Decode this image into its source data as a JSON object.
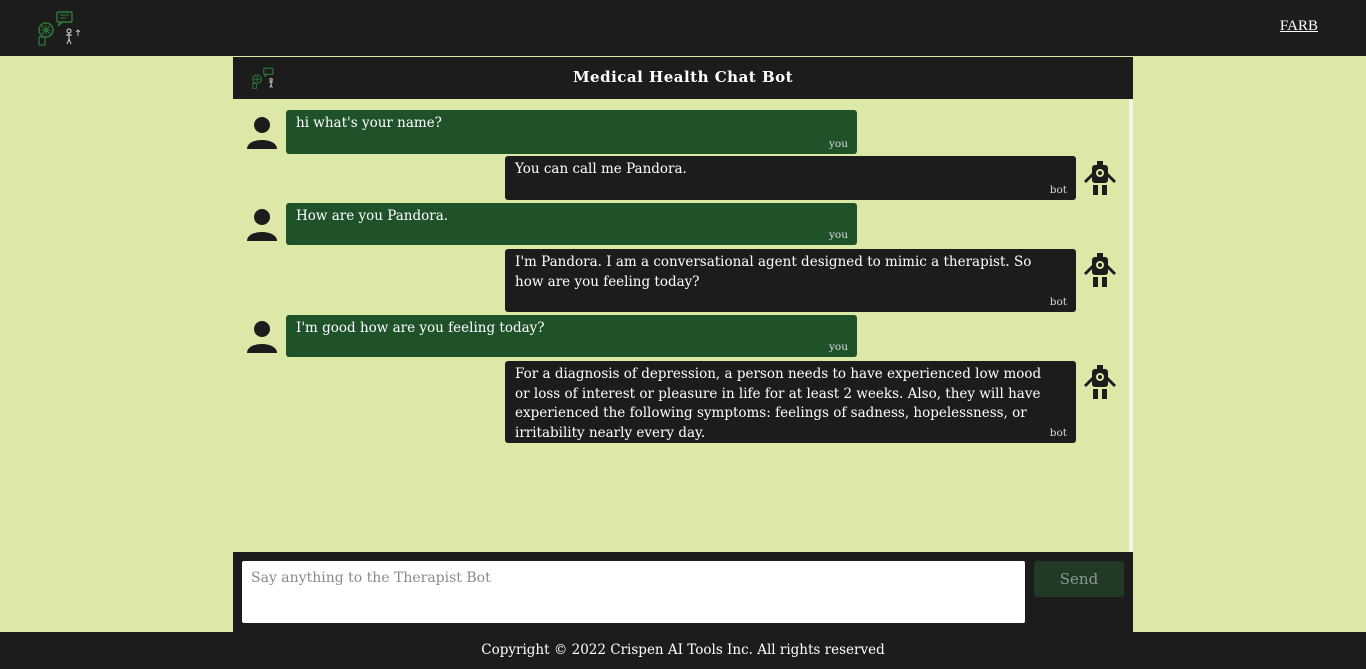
{
  "navbar": {
    "logo_icon": "chatbot-logo-icon",
    "link_label": "FARB"
  },
  "chat": {
    "title": "Medical Health Chat Bot",
    "header_icon": "chatbot-logo-icon",
    "messages": [
      {
        "sender": "user",
        "text": "hi what's your name?",
        "tag": "you"
      },
      {
        "sender": "bot",
        "text": "You can call me Pandora.",
        "tag": "bot"
      },
      {
        "sender": "user",
        "text": "How are you Pandora.",
        "tag": "you"
      },
      {
        "sender": "bot",
        "text": "I'm Pandora. I am a conversational agent designed to mimic a therapist. So how are you feeling today?",
        "tag": "bot"
      },
      {
        "sender": "user",
        "text": "I'm good how are you feeling today?",
        "tag": "you"
      },
      {
        "sender": "bot",
        "text": "For a diagnosis of depression, a person needs to have experienced low mood or loss of interest or pleasure in life for at least 2 weeks. Also, they will have experienced the following symptoms: feelings of sadness, hopelessness, or irritability nearly every day.",
        "tag": "bot"
      }
    ],
    "input_placeholder": "Say anything to the Therapist Bot",
    "input_value": "",
    "send_label": "Send"
  },
  "footer": {
    "text": "Copyright © 2022 Crispen AI Tools Inc. All rights reserved"
  },
  "colors": {
    "page_bg": "#dbe8a8",
    "dark": "#1c1c1c",
    "user_bubble": "#20522a",
    "bot_bubble": "#1c1c1c",
    "send_button": "#203a25"
  }
}
